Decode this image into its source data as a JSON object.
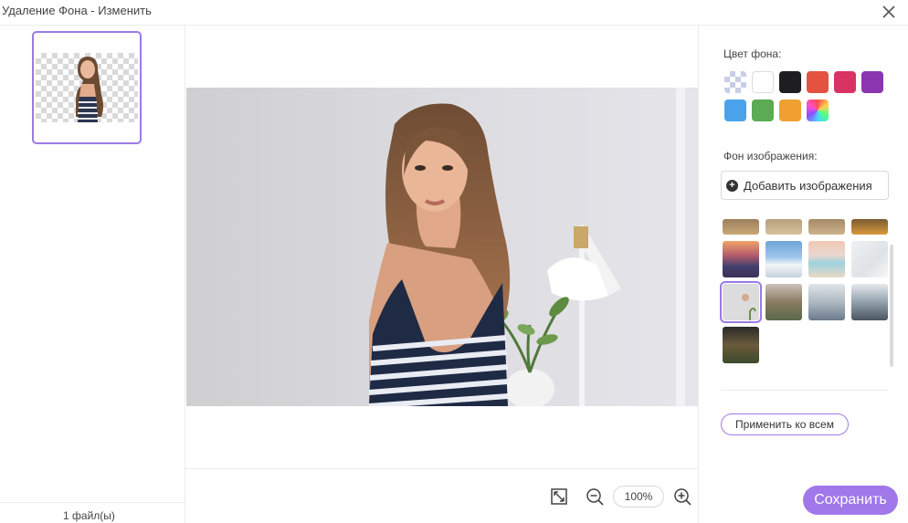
{
  "window": {
    "title": "Удаление Фона -  Изменить"
  },
  "files": {
    "count_label": "1 файл(ы)"
  },
  "toolbar": {
    "zoom": "100%"
  },
  "right_panel": {
    "bg_color_label": "Цвет фона:",
    "bg_image_label": "Фон изображения:",
    "add_image_label": "Добавить изображения",
    "apply_all_label": "Применить ко всем",
    "swatches": [
      {
        "name": "transparent",
        "color": "transparent"
      },
      {
        "name": "white",
        "color": "#ffffff"
      },
      {
        "name": "black",
        "color": "#1e1e22"
      },
      {
        "name": "orange-red",
        "color": "#e3533f"
      },
      {
        "name": "crimson",
        "color": "#d93363"
      },
      {
        "name": "purple",
        "color": "#8b35b0"
      },
      {
        "name": "sky-blue",
        "color": "#4aa3ea"
      },
      {
        "name": "green",
        "color": "#5aab53"
      },
      {
        "name": "orange",
        "color": "#f0a030"
      },
      {
        "name": "rainbow",
        "color": "multicolor"
      }
    ],
    "bg_images": [
      {
        "name": "beach-sunset"
      },
      {
        "name": "beach-sand"
      },
      {
        "name": "seaside-path"
      },
      {
        "name": "desert-horizon"
      },
      {
        "name": "ocean-sunset"
      },
      {
        "name": "snowy-mountains"
      },
      {
        "name": "pastel-beach"
      },
      {
        "name": "white-room"
      },
      {
        "name": "minimal-wall"
      },
      {
        "name": "cafe-interior"
      },
      {
        "name": "office-interior"
      },
      {
        "name": "modern-office"
      },
      {
        "name": "night-building"
      }
    ]
  },
  "actions": {
    "save_label": "Сохранить"
  },
  "colors": {
    "accent": "#a078ea",
    "accent_border": "#9b7ae6"
  }
}
